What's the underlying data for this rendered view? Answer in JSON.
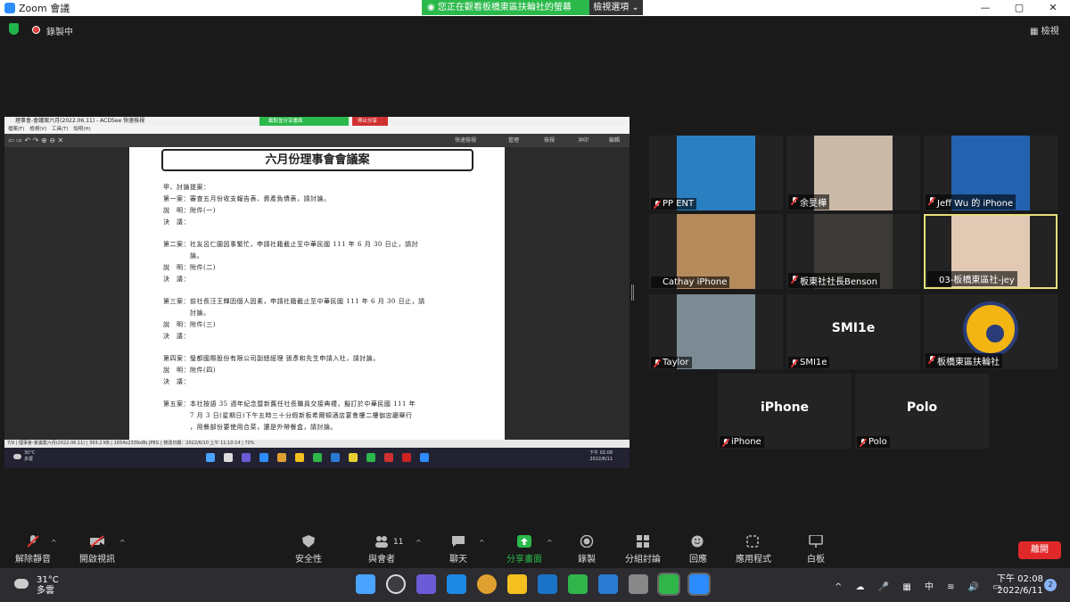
{
  "window": {
    "title": "Zoom 會議",
    "minimize": "—",
    "maximize": "▢",
    "close": "✕"
  },
  "share_banner": {
    "text": "您正在觀看板橋東區扶輪社的螢幕",
    "view_options": "檢視選項"
  },
  "meeting_bar": {
    "recording_label": "錄製中",
    "view_label": "檢視"
  },
  "shared_screen": {
    "app_title": "理事會-會議案六月(2022.06.11) - ACDSee 快速檢視",
    "sharing_banner": "截取並分享畫面",
    "stop_share": "停止分享",
    "menu": "檔案(F)  檢視(V)  工具(T)  說明(H)",
    "tools": [
      "快速檢視",
      "管理",
      "檢視",
      "沖印",
      "編輯"
    ],
    "status": "7/9 | 理事會-會議案六月(2022.06.11) | 393.2 KB | 1654x2339x8b JPEG | 修改日期：2022/6/10 上午 11:10:14 | 70%",
    "doc_title": "六月份理事會會議案",
    "doc_lines": [
      "甲、討論提案：",
      "第一案：審查五月份收支報告表、資產負債表，請討論。",
      "說　明：附件(一)",
      "決　議：",
      "第二案：社友呂仁園因事繁忙，申請社籍截止至中華民國 111 年 6 月 30 日止，請討",
      "　　　　論。",
      "說　明：附件(二)",
      "決　議：",
      "第三案：前社長汪王輝因個人因素，申請社籍截止至中華民國 111 年 6 月 30 日止，請",
      "　　　　討論。",
      "說　明：附件(三)",
      "決　議：",
      "第四案：璧都國際股份有限公司副總經理 張彥和先生申請入社，請討論。",
      "說　明：附件(四)",
      "決　議：",
      "第五案：本社按語 35 週年紀念暨新舊任社長職員交接典禮，擬訂於中華民國 111 年",
      "　　　　7 月 3 日(星期日)下午五時三十分假新板希爾頓酒店宴會樓二樓伽忠廳舉行",
      "　　　　，用餐部份要使用合菜，還是外帶餐盒，請討論。"
    ],
    "mini_taskbar": {
      "temp": "30°C",
      "cond": "多雲",
      "time": "下午 02:08",
      "date": "2022/6/11"
    }
  },
  "participants": [
    {
      "name": "PP ENT",
      "type": "video",
      "muted": true,
      "active": false,
      "color": "#2a7fc1"
    },
    {
      "name": "余旻樺",
      "type": "video",
      "muted": true,
      "active": false,
      "color": "#c9b9a6"
    },
    {
      "name": "Jeff Wu 的 iPhone",
      "type": "video",
      "muted": true,
      "active": false,
      "color": "#2462b0"
    },
    {
      "name": "Cathay iPhone",
      "type": "video",
      "muted": false,
      "active": false,
      "color": "#b58b5c"
    },
    {
      "name": "板東社社長Benson",
      "type": "video",
      "muted": true,
      "active": false,
      "color": "#3c3a36"
    },
    {
      "name": "03-板橋東區社-jey",
      "type": "video",
      "muted": false,
      "active": true,
      "color": "#e2c9b4"
    },
    {
      "name": "Taylor",
      "type": "video",
      "muted": true,
      "active": false,
      "color": "#7c8a93"
    },
    {
      "name": "SMI1e",
      "type": "name",
      "muted": true,
      "active": false,
      "big": "SMI1e"
    },
    {
      "name": "板橋東區扶輪社",
      "type": "logo",
      "muted": true,
      "active": false
    },
    {
      "name": "iPhone",
      "type": "name",
      "muted": true,
      "active": false,
      "big": "iPhone"
    },
    {
      "name": "Polo",
      "type": "name",
      "muted": true,
      "active": false,
      "big": "Polo"
    }
  ],
  "toolbar": {
    "unmute": "解除靜音",
    "start_video": "開啟視訊",
    "security": "安全性",
    "participants": "與會者",
    "participants_count": "11",
    "chat": "聊天",
    "share_screen": "分享畫面",
    "record": "錄製",
    "breakout": "分組討論",
    "reactions": "回應",
    "apps": "應用程式",
    "whiteboard": "白板",
    "leave": "離開"
  },
  "os_taskbar": {
    "temperature": "31°C",
    "condition": "多雲",
    "time": "下午 02:08",
    "date": "2022/6/11",
    "notifications": "2",
    "ime": "中"
  },
  "colors": {
    "zoom_blue": "#2d8cff",
    "share_green": "#2ab94a",
    "leave_red": "#e02828",
    "active_border": "#e6e07a"
  }
}
